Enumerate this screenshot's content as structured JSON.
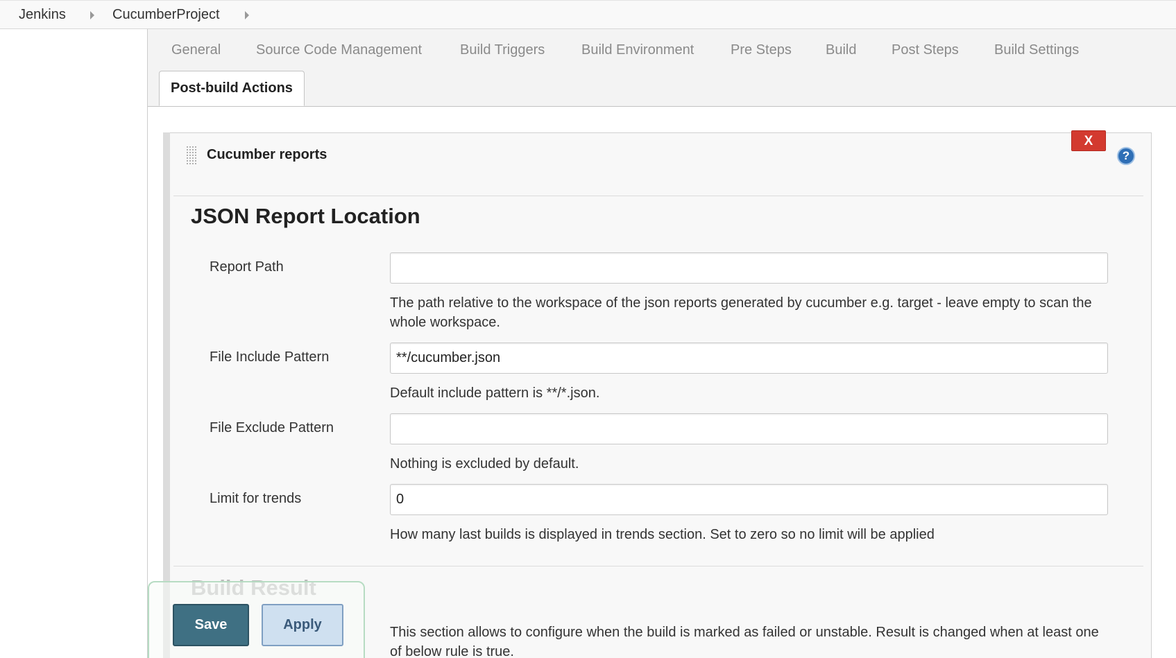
{
  "breadcrumb": {
    "items": [
      "Jenkins",
      "CucumberProject"
    ]
  },
  "tabs": {
    "items": [
      "General",
      "Source Code Management",
      "Build Triggers",
      "Build Environment",
      "Pre Steps",
      "Build",
      "Post Steps",
      "Build Settings"
    ],
    "active": "Post-build Actions"
  },
  "section": {
    "title": "Cucumber reports",
    "delete_label": "X",
    "help_label": "?"
  },
  "json_report": {
    "heading": "JSON Report Location",
    "report_path": {
      "label": "Report Path",
      "value": "",
      "help": "The path relative to the workspace of the json reports generated by cucumber e.g. target - leave empty to scan the whole workspace."
    },
    "include_pattern": {
      "label": "File Include Pattern",
      "value": "**/cucumber.json",
      "help": "Default include pattern is **/*.json."
    },
    "exclude_pattern": {
      "label": "File Exclude Pattern",
      "value": "",
      "help": "Nothing is excluded by default."
    },
    "trends_limit": {
      "label": "Limit for trends",
      "value": "0",
      "help": "How many last builds is displayed in trends section. Set to zero so no limit will be applied"
    }
  },
  "build_result": {
    "heading": "Build Result",
    "help": "This section allows to configure when the build is marked as failed or unstable. Result is changed when at least one of below rule is true."
  },
  "buttons": {
    "save": "Save",
    "apply": "Apply"
  },
  "colors": {
    "delete": "#d33a2f",
    "save": "#3f7083",
    "apply": "#cfe0f0",
    "help_icon": "#2f6fb6"
  }
}
